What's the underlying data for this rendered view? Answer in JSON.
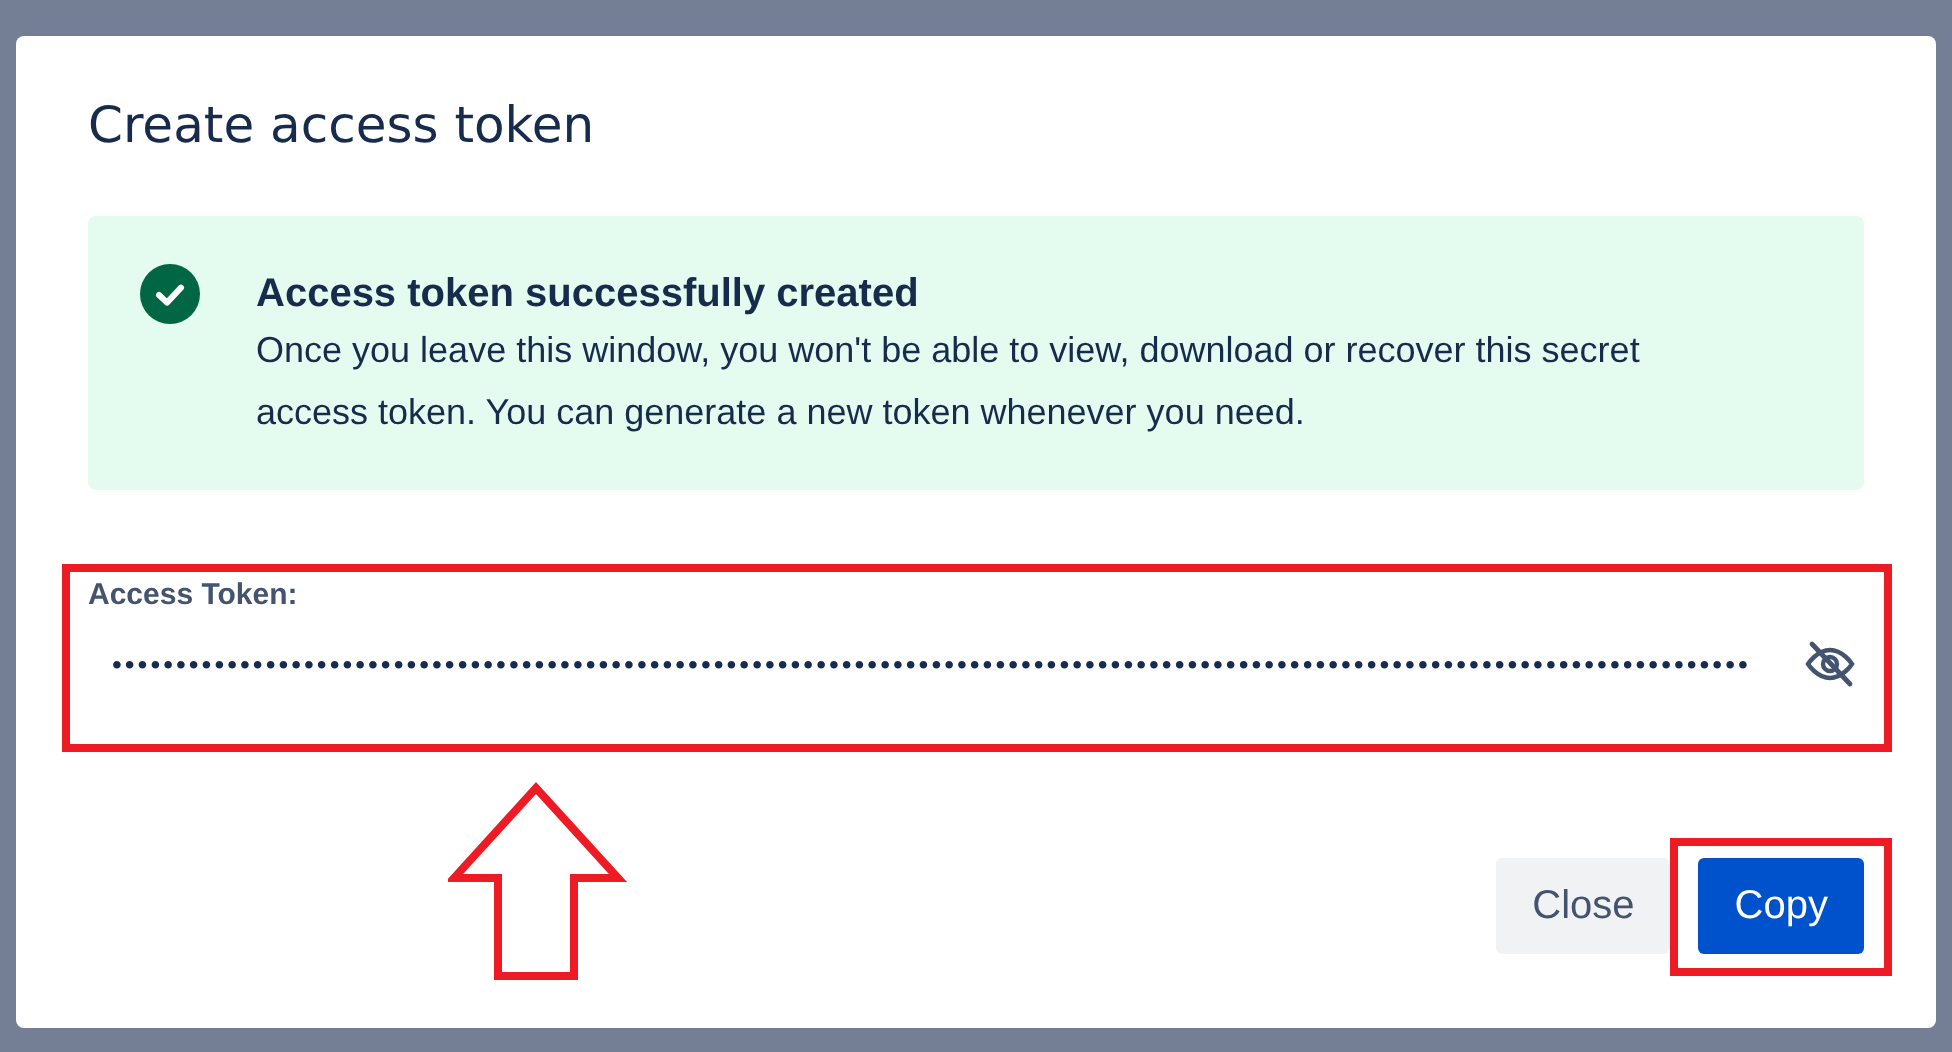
{
  "dialog": {
    "title": "Create access token"
  },
  "banner": {
    "kind": "success",
    "heading": "Access token successfully created",
    "message": "Once you leave this window, you won't be able to view, download or recover this secret access token. You can generate a new token whenever you need."
  },
  "token_field": {
    "label": "Access Token:",
    "value": "••••••••••••••••••••••••••••••••••••••••••••••••••••••••••••••••••••••••••••••••••••••••••••••••••••••••••••••••••••••••••••••••",
    "masked": true
  },
  "buttons": [
    {
      "label": "Close",
      "kind": "subtle"
    },
    {
      "label": "Copy",
      "kind": "primary"
    }
  ],
  "annotations": [
    {
      "kind": "field_box"
    },
    {
      "kind": "button_box"
    },
    {
      "kind": "arrow"
    }
  ]
}
